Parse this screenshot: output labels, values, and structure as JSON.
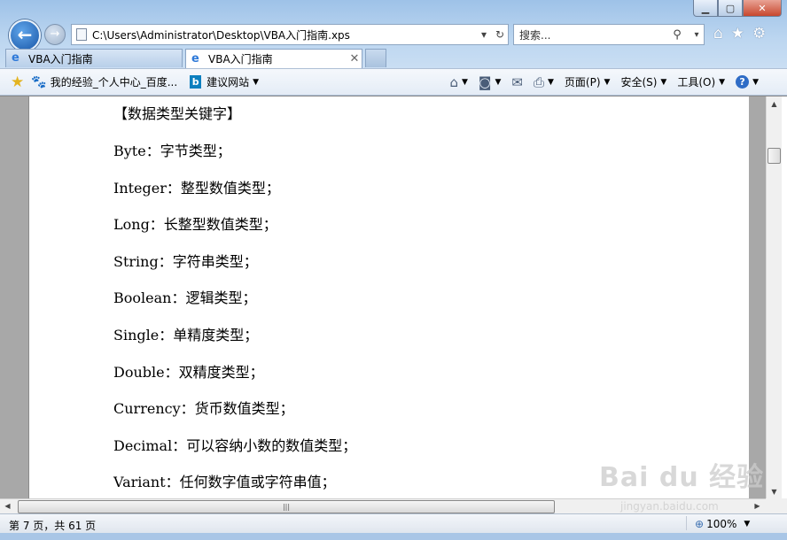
{
  "window": {
    "min_label": "▁",
    "max_label": "▢",
    "close_label": "✕"
  },
  "nav": {
    "back_glyph": "←",
    "forward_glyph": "→",
    "address": "C:\\Users\\Administrator\\Desktop\\VBA入门指南.xps",
    "address_dropdown_glyph": "▾",
    "refresh_glyph": "↻",
    "search_placeholder": "搜索...",
    "search_glyph": "⚲",
    "search_dropdown_glyph": "▾",
    "home_glyph": "⌂",
    "favorites_glyph": "★",
    "tools_glyph": "⚙"
  },
  "tabs": [
    {
      "label": "VBA入门指南",
      "icon": "e"
    },
    {
      "label": "VBA入门指南",
      "icon": "e",
      "close": "✕"
    }
  ],
  "favorites_bar": {
    "star_glyph": "★",
    "items": [
      {
        "label": "我的经验_个人中心_百度...",
        "icon": "🐾"
      },
      {
        "label": "建议网站",
        "icon": "b",
        "caret": "▼"
      }
    ]
  },
  "command_bar": {
    "home_glyph": "⌂",
    "feeds_glyph": "◙",
    "mail_glyph": "✉",
    "print_glyph": "⎙",
    "caret": "▼",
    "page_label": "页面(P)",
    "safety_label": "安全(S)",
    "tools_label": "工具(O)",
    "help_glyph": "?"
  },
  "document": {
    "lines": [
      "【数据类型关键字】",
      "Byte：字节类型；",
      "Integer：整型数值类型；",
      "Long：长整型数值类型；",
      "String：字符串类型；",
      "Boolean：逻辑类型；",
      "Single：单精度类型；",
      "Double：双精度类型；",
      "Currency：货币数值类型；",
      "Decimal：可以容纳小数的数值类型；",
      "Variant：任何数字值或字符串值；"
    ]
  },
  "scrollbars": {
    "up": "▲",
    "down": "▼",
    "left": "◀",
    "right": "▶",
    "grip": "|||"
  },
  "status_bar": {
    "page_info": "第 7 页，共 61 页",
    "zoom": "100%",
    "zoom_glyph": "⊕",
    "zoom_caret": "▼"
  },
  "watermark": {
    "main": "Bai du 经验",
    "sub": "jingyan.baidu.com"
  }
}
